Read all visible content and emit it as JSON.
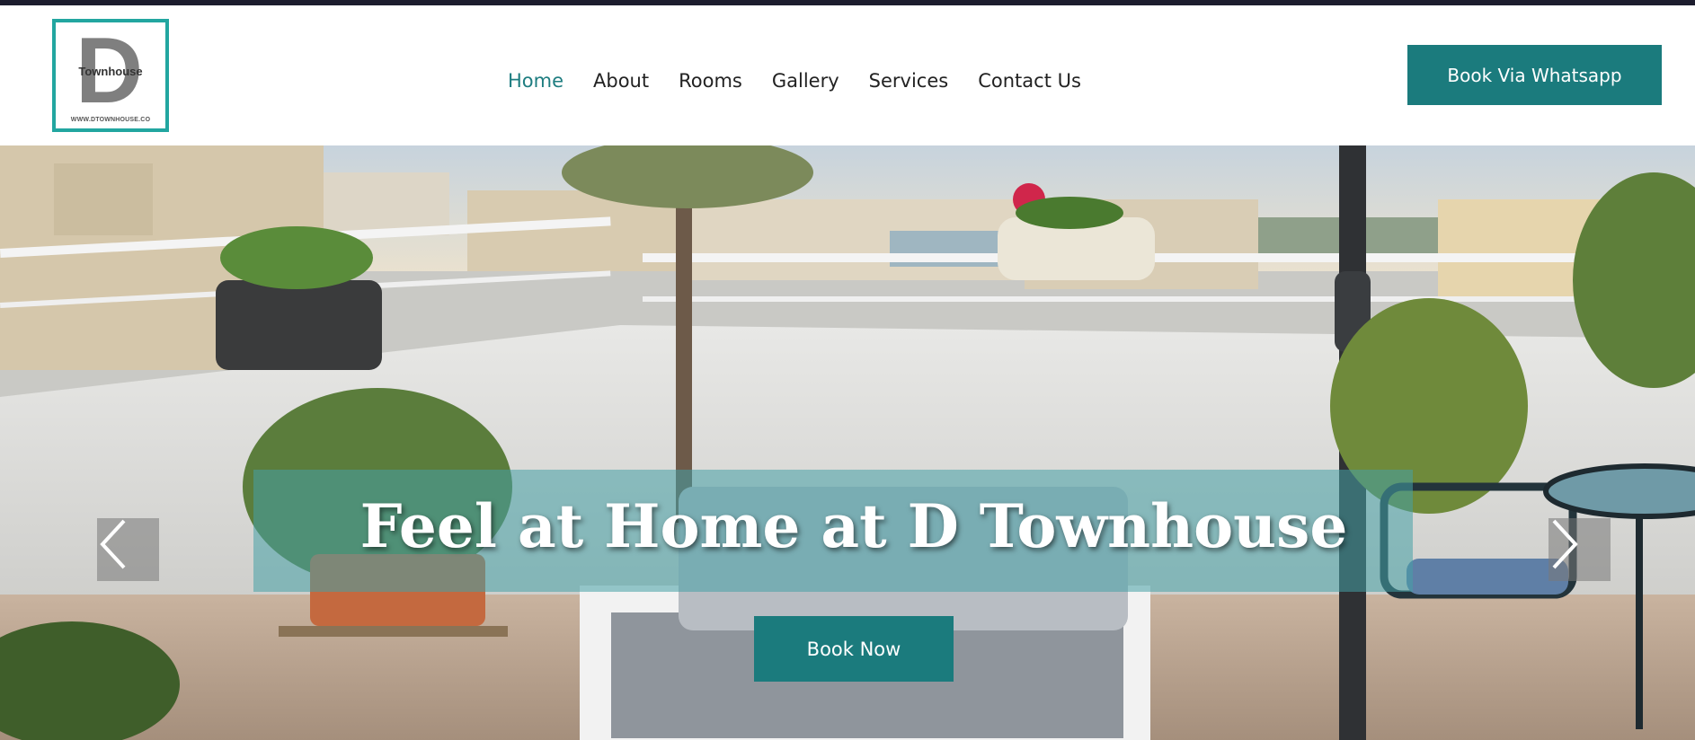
{
  "header": {
    "logo": {
      "letter": "D",
      "word": "Townhouse",
      "url": "WWW.DTOWNHOUSE.CO"
    },
    "nav": [
      {
        "label": "Home",
        "active": true
      },
      {
        "label": "About",
        "active": false
      },
      {
        "label": "Rooms",
        "active": false
      },
      {
        "label": "Gallery",
        "active": false
      },
      {
        "label": "Services",
        "active": false
      },
      {
        "label": "Contact Us",
        "active": false
      }
    ],
    "cta_label": "Book Via Whatsapp"
  },
  "hero": {
    "headline": "Feel at Home at D Townhouse",
    "button_label": "Book Now",
    "prev_icon": "chevron-left-icon",
    "next_icon": "chevron-right-icon"
  },
  "colors": {
    "accent": "#1b7b7d",
    "nav_active": "#1e7d80",
    "logo_border": "#22a6a0",
    "top_bar": "#1c1d2e"
  }
}
